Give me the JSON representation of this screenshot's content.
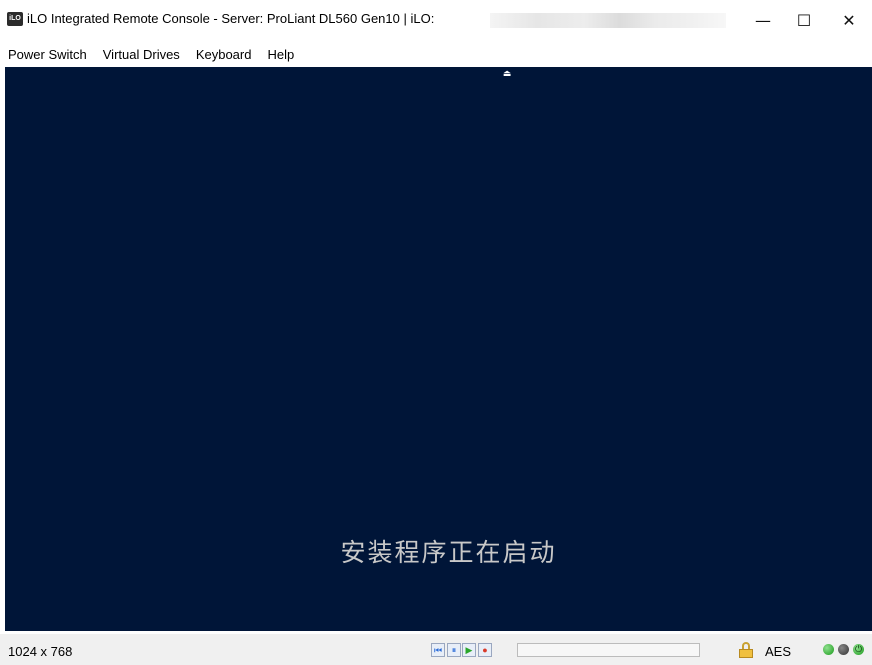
{
  "window": {
    "title": "iLO Integrated Remote Console - Server: ProLiant DL560 Gen10 | iLO:",
    "app_icon_text": "iLO",
    "controls": {
      "minimize": "—",
      "maximize": "☐",
      "close": "✕"
    }
  },
  "menu": {
    "items": [
      "Power Switch",
      "Virtual Drives",
      "Keyboard",
      "Help"
    ]
  },
  "console": {
    "message": "安装程序正在启动",
    "eject_icon": "eject-icon"
  },
  "status": {
    "resolution": "1024 x 768",
    "playback": {
      "rewind": "⏮",
      "pause": "⏸",
      "play": "▶",
      "record": "●"
    },
    "progress_fraction": 0.0,
    "encryption": "AES",
    "leds": {
      "power_symbol": "⏻"
    }
  },
  "colors": {
    "console_bg": "#001538",
    "console_text": "#c8c8c8"
  }
}
